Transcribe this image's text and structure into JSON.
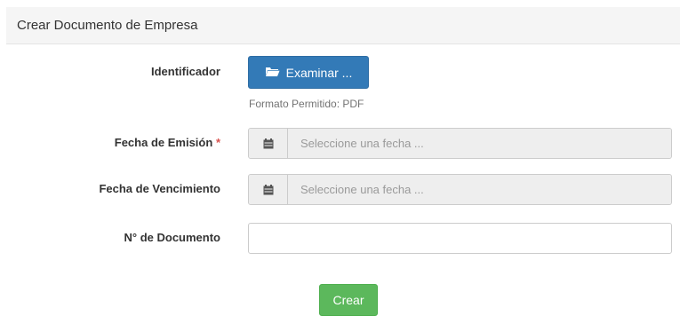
{
  "panel": {
    "title": "Crear Documento de Empresa"
  },
  "form": {
    "identificador": {
      "label": "Identificador",
      "button_label": "Examinar ...",
      "button_icon": "folder-open-icon",
      "help_text": "Formato Permitido: PDF"
    },
    "fecha_emision": {
      "label": "Fecha de Emisión",
      "required_mark": "*",
      "icon": "calendar-icon",
      "placeholder": "Seleccione una fecha ..."
    },
    "fecha_vencimiento": {
      "label": "Fecha de Vencimiento",
      "icon": "calendar-icon",
      "placeholder": "Seleccione una fecha ..."
    },
    "numero_documento": {
      "label": "N° de Documento",
      "value": ""
    },
    "submit_label": "Crear"
  },
  "colors": {
    "primary": "#337ab7",
    "success": "#5cb85c",
    "required": "#d9534f",
    "heading_bg": "#f5f5f5"
  }
}
